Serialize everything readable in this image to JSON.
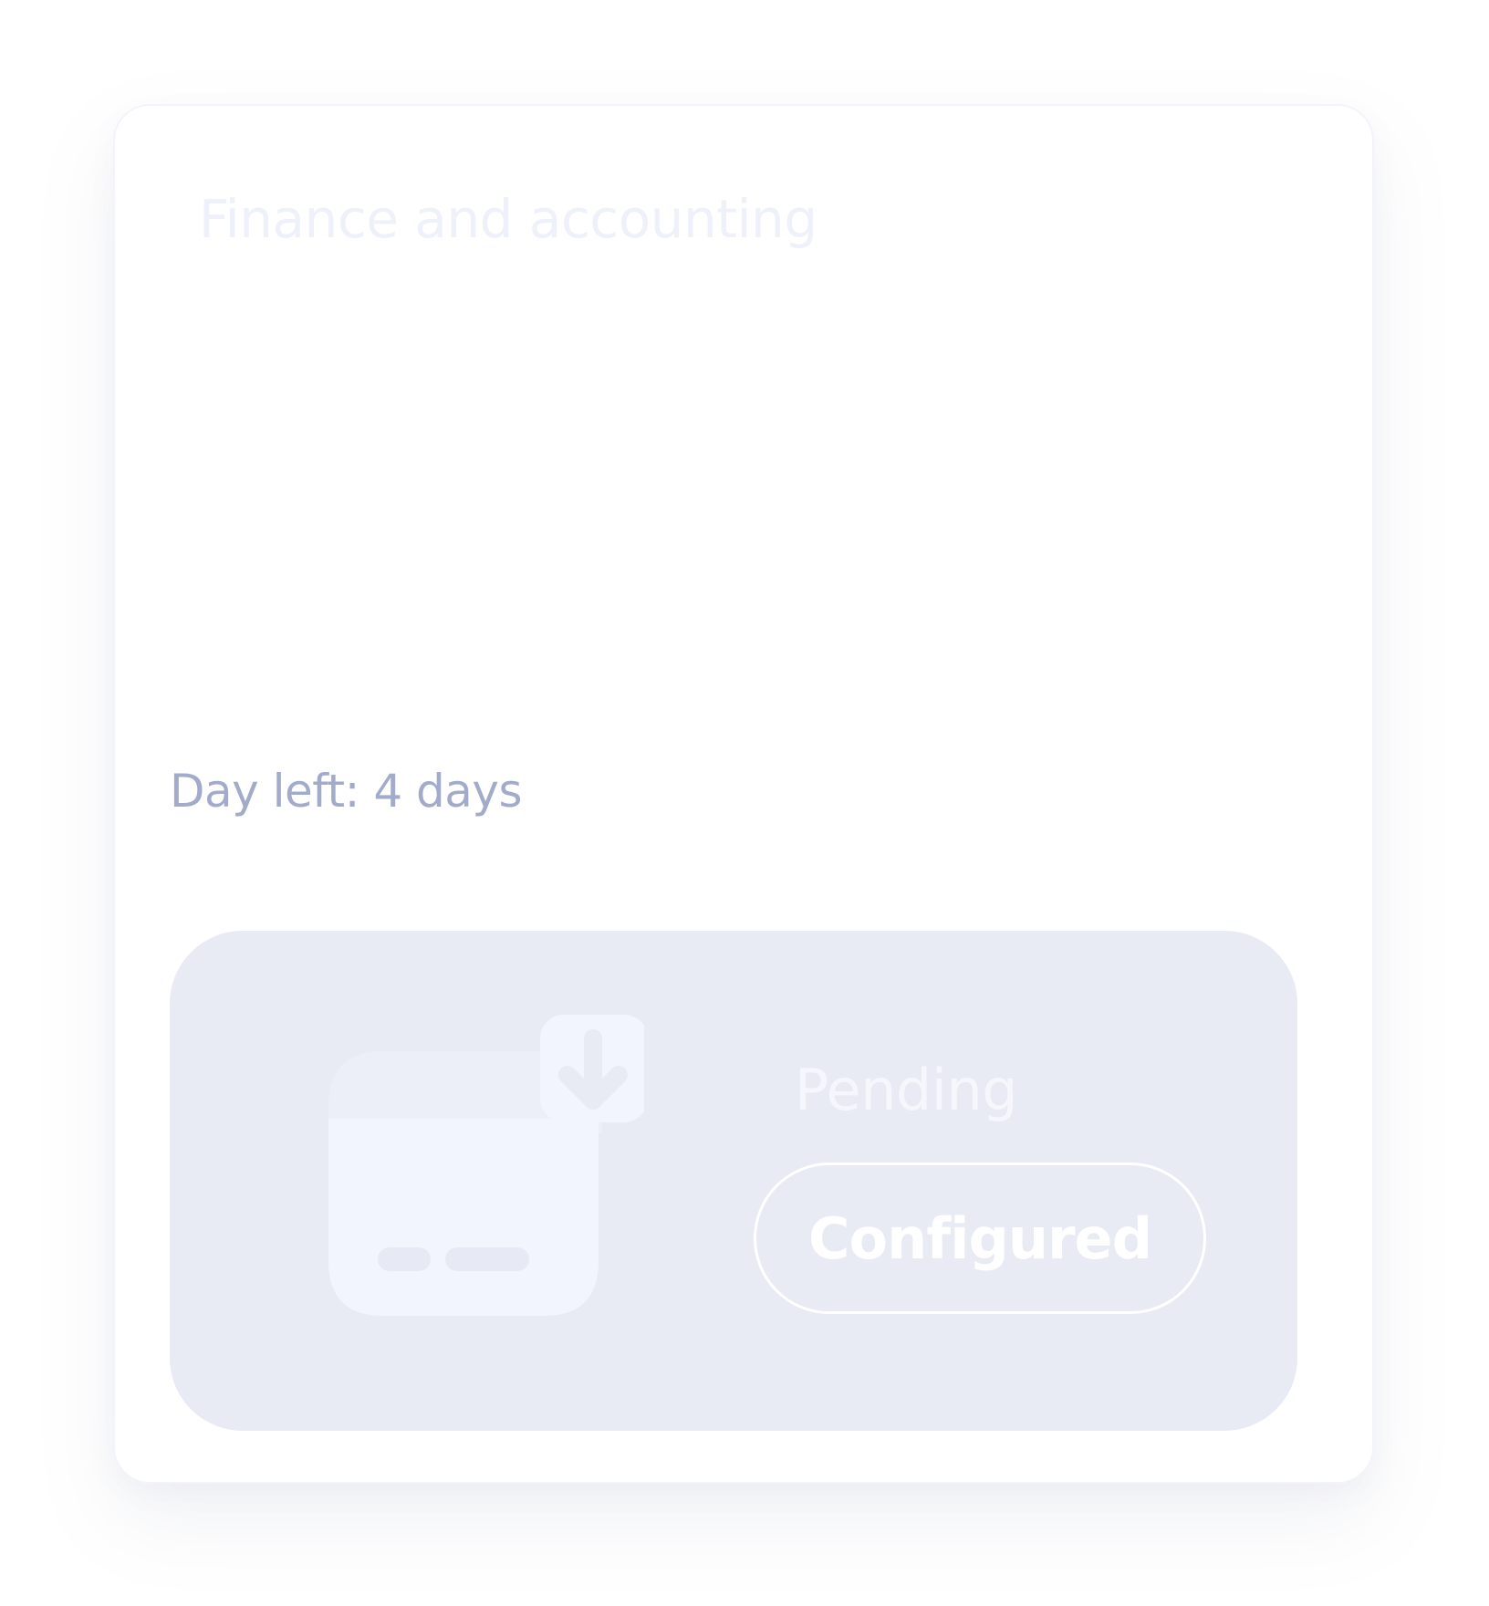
{
  "card": {
    "title": "Finance and accounting",
    "days_left": "Day left: 4 days"
  },
  "status": {
    "label": "Pending",
    "button_label": "Configured",
    "illustration_icon": "credit-card-download-icon"
  },
  "colors": {
    "panel_background": "#e8eaf4",
    "illustration_fill": "#f2f5fe",
    "days_text": "#a3abcb",
    "title_text": "#eef1fa"
  }
}
